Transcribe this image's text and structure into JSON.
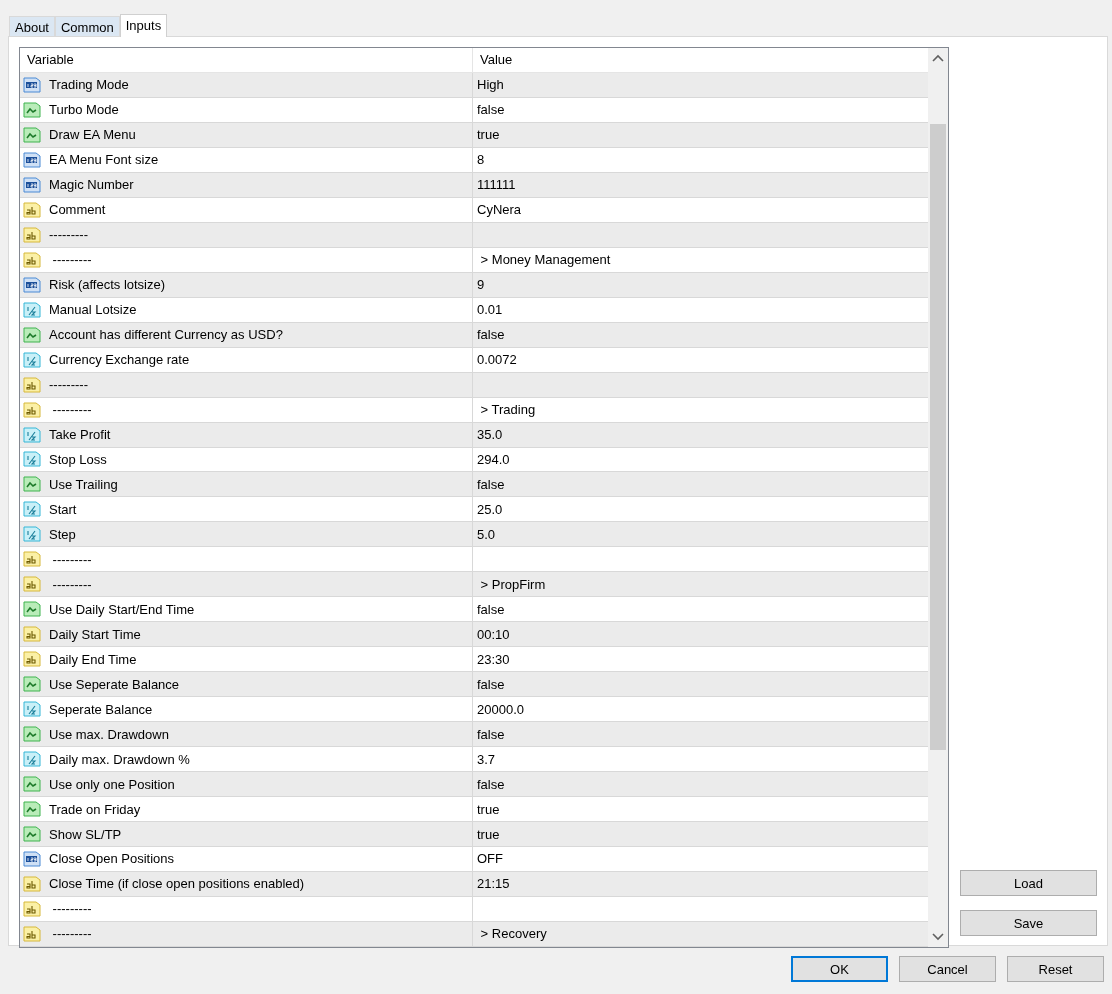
{
  "tabs": [
    {
      "label": "About",
      "selected": false
    },
    {
      "label": "Common",
      "selected": false
    },
    {
      "label": "Inputs",
      "selected": true
    }
  ],
  "table": {
    "columns": [
      "Variable",
      "Value"
    ],
    "rows": [
      {
        "kind": "int",
        "variable": "Trading Mode",
        "value": "High"
      },
      {
        "kind": "bool",
        "variable": "Turbo Mode",
        "value": "false"
      },
      {
        "kind": "bool",
        "variable": "Draw EA Menu",
        "value": "true"
      },
      {
        "kind": "int",
        "variable": "EA Menu Font size",
        "value": "8"
      },
      {
        "kind": "int",
        "variable": "Magic Number",
        "value": "111111"
      },
      {
        "kind": "string",
        "variable": "Comment",
        "value": "CyNera"
      },
      {
        "kind": "string",
        "variable": "---------"
      },
      {
        "kind": "string",
        "variable": " ---------",
        "value": " > Money Management"
      },
      {
        "kind": "int",
        "variable": "Risk (affects lotsize)",
        "value": "9"
      },
      {
        "kind": "double",
        "variable": "Manual Lotsize",
        "value": "0.01"
      },
      {
        "kind": "bool",
        "variable": "Account has different Currency as USD?",
        "value": "false"
      },
      {
        "kind": "double",
        "variable": "Currency Exchange rate",
        "value": "0.0072"
      },
      {
        "kind": "string",
        "variable": "---------"
      },
      {
        "kind": "string",
        "variable": " ---------",
        "value": " > Trading"
      },
      {
        "kind": "double",
        "variable": "Take Profit",
        "value": "35.0"
      },
      {
        "kind": "double",
        "variable": "Stop Loss",
        "value": "294.0"
      },
      {
        "kind": "bool",
        "variable": "Use Trailing",
        "value": "false"
      },
      {
        "kind": "double",
        "variable": "Start",
        "value": "25.0"
      },
      {
        "kind": "double",
        "variable": "Step",
        "value": "5.0"
      },
      {
        "kind": "string",
        "variable": " ---------"
      },
      {
        "kind": "string",
        "variable": " ---------",
        "value": " > PropFirm"
      },
      {
        "kind": "bool",
        "variable": "Use Daily Start/End Time",
        "value": "false"
      },
      {
        "kind": "string",
        "variable": "Daily Start Time",
        "value": "00:10"
      },
      {
        "kind": "string",
        "variable": "Daily End Time",
        "value": "23:30"
      },
      {
        "kind": "bool",
        "variable": "Use Seperate Balance",
        "value": "false"
      },
      {
        "kind": "double",
        "variable": "Seperate Balance",
        "value": "20000.0"
      },
      {
        "kind": "bool",
        "variable": "Use max. Drawdown",
        "value": "false"
      },
      {
        "kind": "double",
        "variable": "Daily max. Drawdown %",
        "value": "3.7"
      },
      {
        "kind": "bool",
        "variable": "Use only one Position",
        "value": "false"
      },
      {
        "kind": "bool",
        "variable": "Trade on Friday",
        "value": "true"
      },
      {
        "kind": "bool",
        "variable": "Show SL/TP",
        "value": "true"
      },
      {
        "kind": "int",
        "variable": "Close Open Positions",
        "value": "OFF"
      },
      {
        "kind": "string",
        "variable": "Close Time (if close open positions enabled)",
        "value": "21:15"
      },
      {
        "kind": "string",
        "variable": " ---------"
      },
      {
        "kind": "string",
        "variable": " ---------",
        "value": " > Recovery"
      }
    ]
  },
  "side_buttons": [
    "Load",
    "Save"
  ],
  "buttons": [
    {
      "label": "OK",
      "default": true
    },
    {
      "label": "Cancel",
      "default": false
    },
    {
      "label": "Reset",
      "default": false
    }
  ]
}
